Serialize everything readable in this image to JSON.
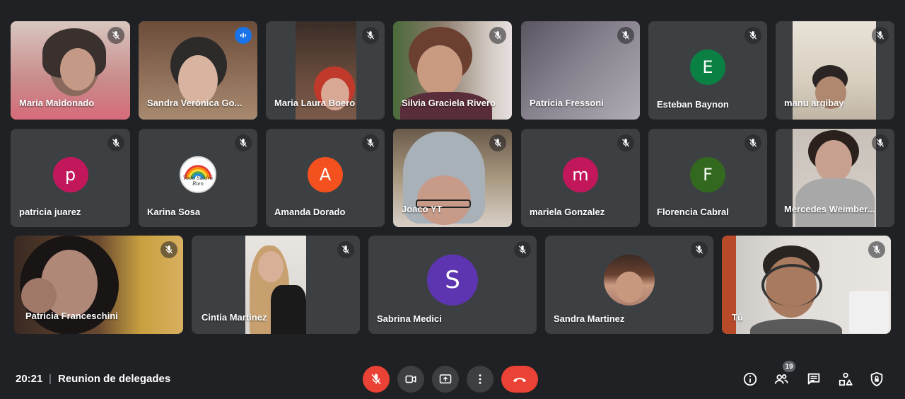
{
  "participants": [
    {
      "name": "Maria Maldonado",
      "type": "video",
      "muted": true
    },
    {
      "name": "Sandra Verónica Go...",
      "type": "video",
      "muted": false,
      "speaking": true
    },
    {
      "name": "Maria Laura Boero",
      "type": "video",
      "muted": true
    },
    {
      "name": "Silvia Graciela Rivero",
      "type": "video",
      "muted": true
    },
    {
      "name": "Patricia Fressoni",
      "type": "video",
      "muted": true
    },
    {
      "name": "Esteban Baynon",
      "type": "initial",
      "initial": "E",
      "color": "#0b8043",
      "muted": true
    },
    {
      "name": "manu argibay",
      "type": "video",
      "muted": true
    },
    {
      "name": "patricia juarez",
      "type": "initial",
      "initial": "p",
      "color": "#c2185b",
      "muted": true
    },
    {
      "name": "Karina Sosa",
      "type": "photo-avatar",
      "avatar_text": "Todo Saldrá Bien",
      "muted": true
    },
    {
      "name": "Amanda Dorado",
      "type": "initial",
      "initial": "A",
      "color": "#f4511e",
      "muted": true
    },
    {
      "name": "Joaco YT",
      "type": "video",
      "muted": true
    },
    {
      "name": "mariela Gonzalez",
      "type": "initial",
      "initial": "m",
      "color": "#c2185b",
      "muted": true
    },
    {
      "name": "Florencia Cabral",
      "type": "initial",
      "initial": "F",
      "color": "#33691e",
      "muted": true
    },
    {
      "name": "Mercedes Weimber...",
      "type": "video",
      "muted": true
    },
    {
      "name": "Patricia Franceschini",
      "type": "video",
      "muted": true
    },
    {
      "name": "Cintia Martinez",
      "type": "video",
      "muted": true
    },
    {
      "name": "Sabrina Medici",
      "type": "initial",
      "initial": "S",
      "color": "#5e35b1",
      "muted": true
    },
    {
      "name": "Sandra Martinez",
      "type": "photo-avatar",
      "muted": true
    },
    {
      "name": "Tú",
      "type": "video",
      "muted": true
    }
  ],
  "meeting": {
    "time": "20:21",
    "separator": "|",
    "title": "Reunion de delegades"
  },
  "controls": {
    "mic": "mic-off-icon",
    "camera": "videocam-icon",
    "present": "present-screen-icon",
    "more": "more-options-icon",
    "leave": "leave-call-icon"
  },
  "right_controls": {
    "people_count": "19"
  },
  "colors": {
    "background": "#202124",
    "tile": "#3c4043",
    "red": "#ea4335",
    "speaking": "#1a73e8"
  }
}
